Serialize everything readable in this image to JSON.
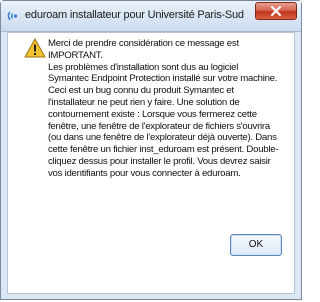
{
  "window": {
    "title": "eduroam installateur pour Université Paris-Sud"
  },
  "dialog": {
    "message": "Merci de prendre considération ce message est IMPORTANT.\nLes problèmes d'installation sont dus au logiciel Symantec Endpoint Protection installé sur votre machine.\nCeci est un bug connu du produit Symantec et l'installateur ne peut rien y faire. Une solution de contournement existe : Lorsque vous fermerez cette fenêtre, une fenêtre de l'explorateur de fichiers s'ouvrira (ou dans une fenêtre de l'explorateur déjà ouverte). Dans cette fenêtre un fichier inst_eduroam est présent. Double-cliquez dessus pour installer le profil. Vous devrez saisir vos identifiants pour vous connecter à eduroam.",
    "ok_label": "OK"
  },
  "icons": {
    "app": "app-icon",
    "close": "close-icon",
    "warning": "warning-icon"
  },
  "colors": {
    "close_button": "#c0331d",
    "warning_yellow": "#f2c230"
  }
}
